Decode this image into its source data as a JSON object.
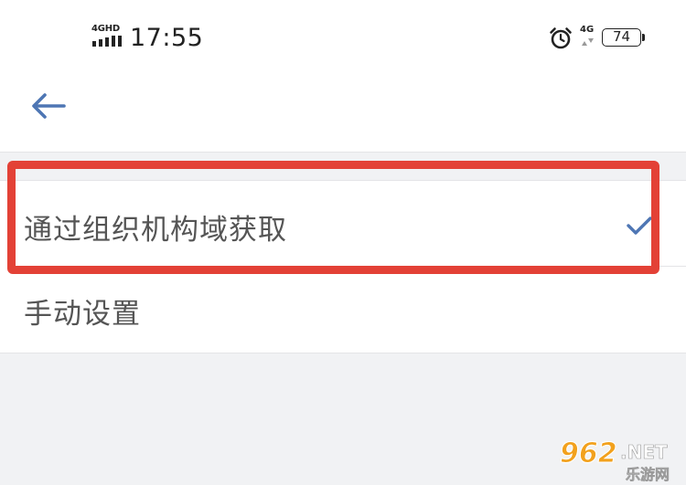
{
  "status_bar": {
    "network_left": "4GHD",
    "time": "17:55",
    "network_right": "4G",
    "battery_level": "74",
    "alarm_icon": "alarm-clock-icon"
  },
  "nav_bar": {
    "back_icon": "arrow-left-icon"
  },
  "options": [
    {
      "label": "通过组织机构域获取",
      "selected": true,
      "icon": "check-icon"
    },
    {
      "label": "手动设置",
      "selected": false
    }
  ],
  "annotation": {
    "color": "#e34136",
    "target": "option-1"
  },
  "watermark": {
    "brand": "962",
    "suffix": ".NET",
    "subtitle": "乐游网"
  },
  "colors": {
    "accent": "#4e76b4",
    "text": "#555555",
    "background": "#f1f2f4",
    "annotation": "#e34136"
  }
}
